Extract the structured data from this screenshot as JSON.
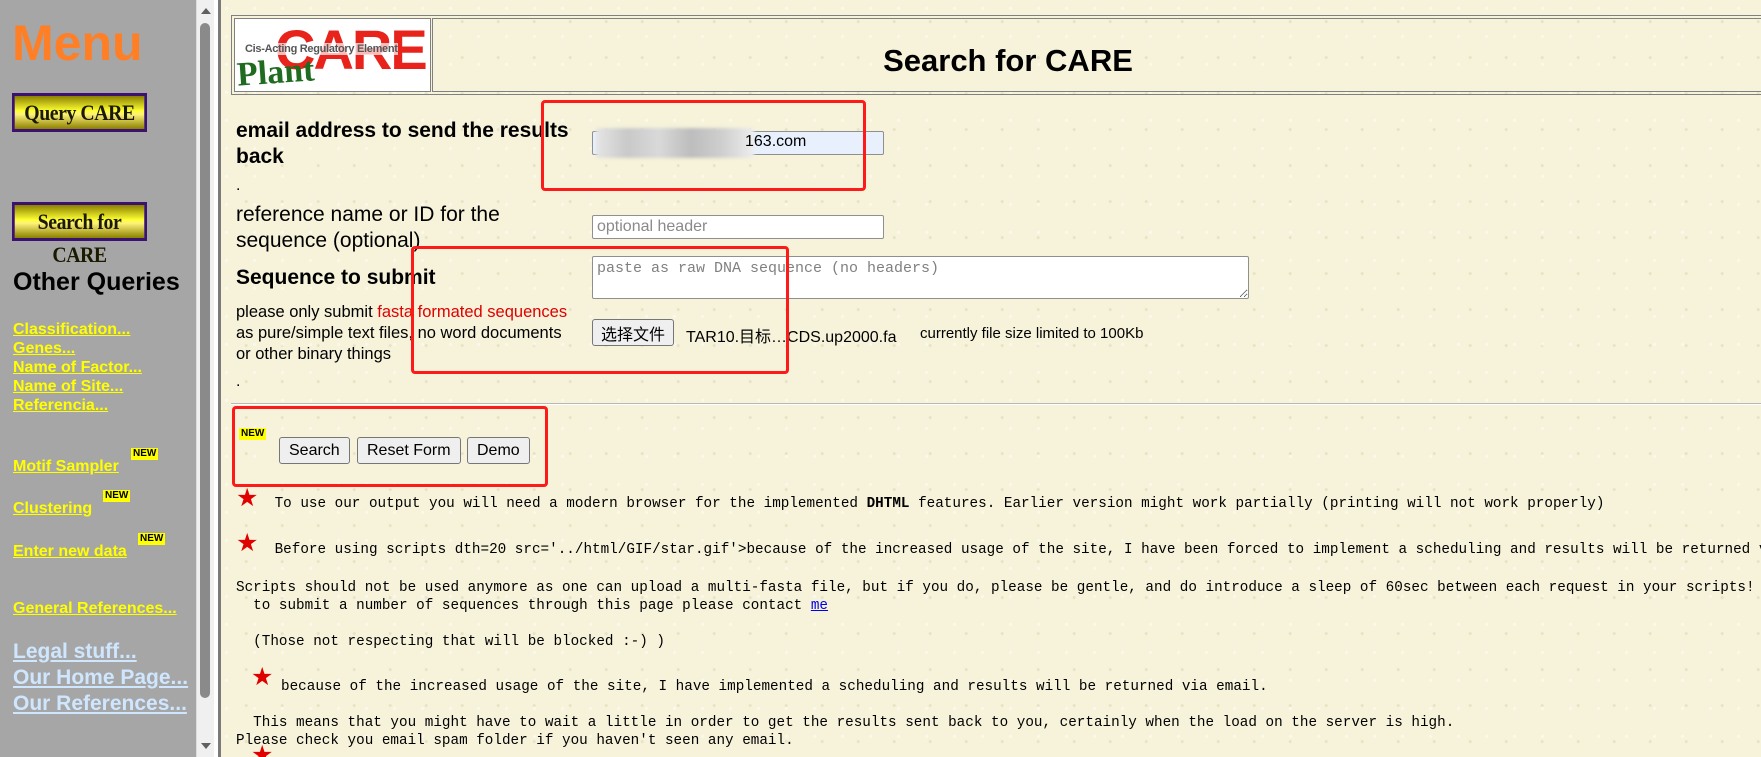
{
  "menu": {
    "title": "Menu",
    "query_care": "Query CARE",
    "search_care": "Search for CARE",
    "other_queries": "Other Queries",
    "links": [
      "Classification...",
      "Genes...",
      "Name of Factor...",
      "Name of Site...",
      "Referencia..."
    ],
    "motif_sampler": "Motif Sampler ",
    "clustering": "Clustering ",
    "enter_new_data": "Enter new data ",
    "new_badge": "NEW",
    "general_references": "General References...",
    "legal": "Legal stuff...",
    "home": "Our Home Page...",
    "references": "Our References..."
  },
  "header": {
    "logo_care": "CARE",
    "logo_plant": "Plant",
    "logo_sub": "Cis-Acting Regulatory Element",
    "title": "Search for CARE"
  },
  "form": {
    "email_label_1": "email address to send the results",
    "email_label_2": "back",
    "email_value": "163.com",
    "dot": ".",
    "ref_label_1": "reference name or ID for the",
    "ref_label_2": "sequence (optional)",
    "ref_placeholder": "optional header",
    "seq_label": "Sequence to submit",
    "seq_placeholder": "paste as raw DNA sequence (no headers)",
    "note_1_prefix": "please only submit ",
    "note_1_red": "fasta formated sequences",
    "note_2": "as pure/simple text files, no word documents",
    "note_3": "or other binary things",
    "file_button": "选择文件",
    "file_name": "TAR10.目标…CDS.up2000.fa",
    "file_limit": "currently file size limited to 100Kb",
    "new_badge": "NEW",
    "search_button": "Search",
    "reset_button": "Reset Form",
    "demo_button": "Demo"
  },
  "info": {
    "star": "★",
    "line1_a": " To use our output you will need a modern browser for the implemented ",
    "line1_b": "DHTML",
    "line1_c": " features. Earlier version might work partially (printing will not work properly)",
    "line2": " Before using scripts dth=20 src='../html/GIF/star.gif'>because of the increased usage of the site, I have been forced to implement a scheduling and results will be returned via email.",
    "line3": "Scripts should not be used anymore as one can upload a multi-fasta file, but if you do, please be gentle, and do introduce a sleep of 60sec between each request in your scripts! Thanks.",
    "line4": "  to submit a number of sequences through this page please contact ",
    "line4_link": "me",
    "line5": "  (Those not respecting that will be blocked :-) )",
    "line6": "because of the increased usage of the site, I have implemented a scheduling and results will be returned via email.",
    "line7": "  This means that you might have to wait a little in order to get the results sent back to you, certainly when the load on the server is high.",
    "line8": "Please check you email spam folder if you haven't seen any email."
  },
  "colors": {
    "menu_bg": "#a6a6a6",
    "menu_title": "#ff7f27",
    "menu_link": "#ffff00",
    "page_bg": "#f7f3da",
    "highlight": "#ff1a1a",
    "star": "#e00000"
  }
}
